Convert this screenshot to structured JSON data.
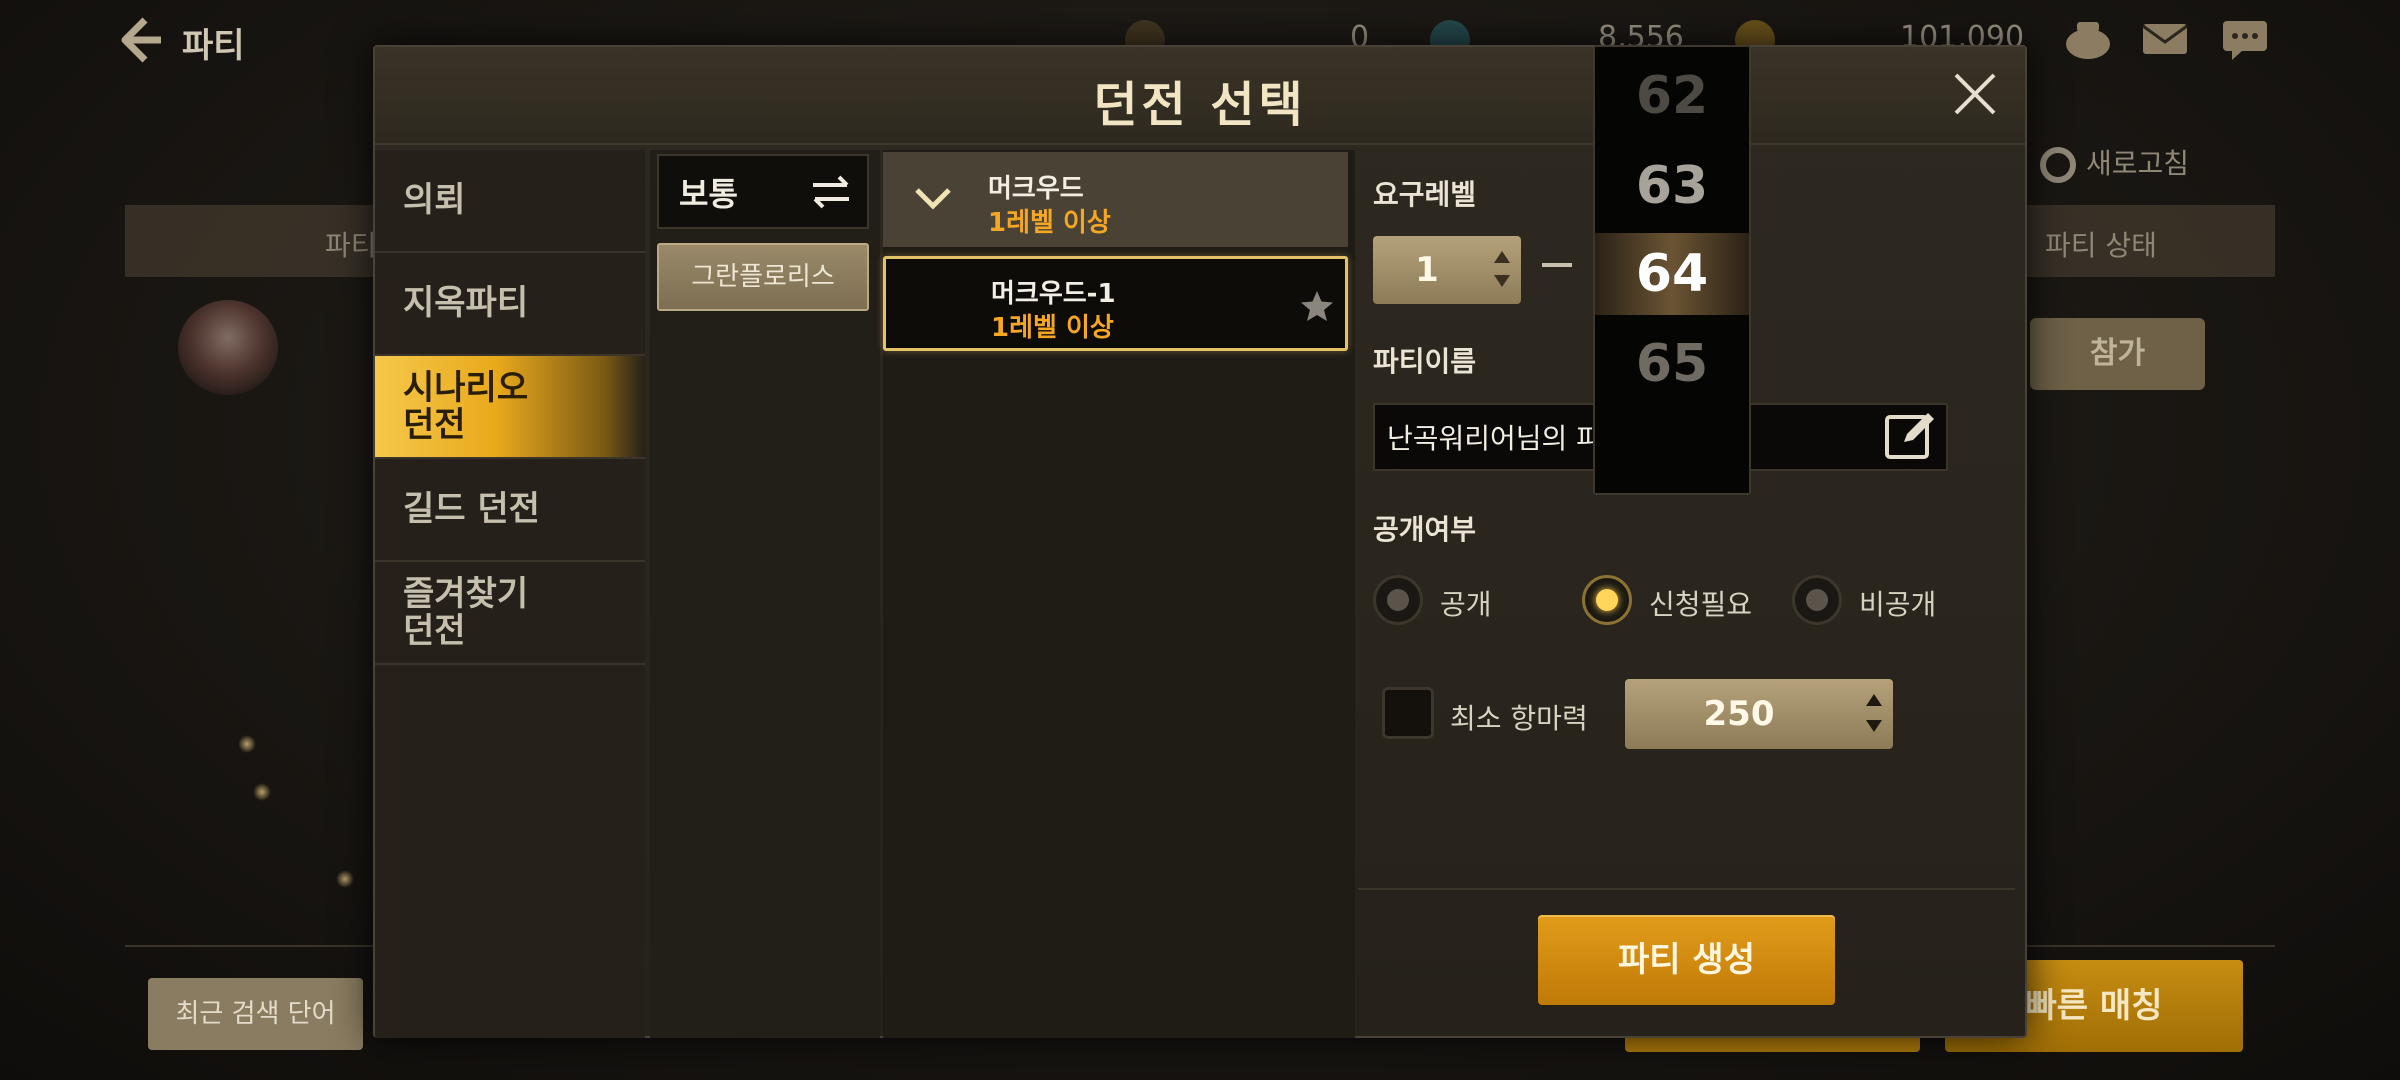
{
  "background": {
    "back_title": "파티",
    "currency_1": "0",
    "currency_2": "8,556",
    "currency_3": "101,090",
    "col_left": "파티",
    "col_right": "파티 상태",
    "refresh": "새로고침",
    "join": "참가",
    "recent_search": "최근 검색 단어",
    "quick_match": "빠른 매칭"
  },
  "modal": {
    "title": "던전 선택",
    "categories": [
      {
        "label": "의뢰"
      },
      {
        "label": "지옥파티"
      },
      {
        "label": "시나리오\n던전"
      },
      {
        "label": "길드 던전"
      },
      {
        "label": "즐겨찾기\n던전"
      }
    ],
    "difficulty": "보통",
    "area": "그란플로리스",
    "dungeon_group": {
      "name": "머크우드",
      "level": "1레벨 이상"
    },
    "dungeon_item": {
      "name": "머크우드-1",
      "level": "1레벨 이상"
    }
  },
  "settings": {
    "required_level_label": "요구레벨",
    "min_level": "1",
    "party_name_label": "파티이름",
    "party_name_value": "난곡워리어님의 파",
    "visibility_label": "공개여부",
    "options": [
      {
        "label": "공개",
        "selected": false
      },
      {
        "label": "신청필요",
        "selected": true
      },
      {
        "label": "비공개",
        "selected": false
      }
    ],
    "min_power_label": "최소 항마력",
    "min_power_value": "250",
    "create_button": "파티 생성"
  },
  "picker": {
    "values": [
      "62",
      "63",
      "64",
      "65"
    ],
    "selected": "64"
  },
  "colors": {
    "accent_gold": "#e29c1a",
    "level_orange": "#f5a623",
    "active_category": "#f5c84a"
  }
}
